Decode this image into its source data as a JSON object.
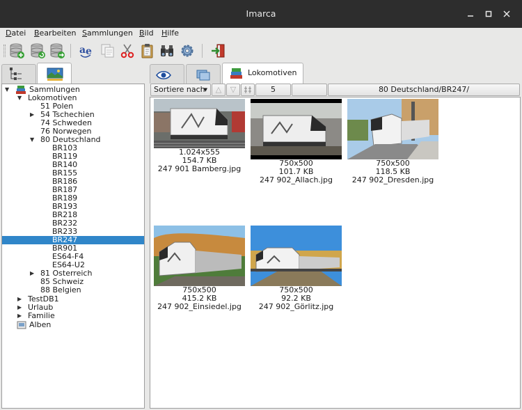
{
  "window": {
    "title": "Imarca"
  },
  "menu": [
    {
      "pre": "",
      "key": "D",
      "rest": "atei"
    },
    {
      "pre": "",
      "key": "B",
      "rest": "earbeiten"
    },
    {
      "pre": "",
      "key": "S",
      "rest": "ammlungen"
    },
    {
      "pre": "",
      "key": "B",
      "rest": "ild"
    },
    {
      "pre": "",
      "key": "H",
      "rest": "ilfe"
    }
  ],
  "toolbar_icons": [
    "database-add-icon",
    "database-refresh-icon",
    "database-sync-icon",
    "spellcheck-icon",
    "copy-icon",
    "cut-icon",
    "paste-icon",
    "binoculars-icon",
    "settings-gear-icon",
    "exit-icon"
  ],
  "tree": {
    "root": "Sammlungen",
    "lokomotiven": "Lokomotiven",
    "items": {
      "polen": "51 Polen",
      "tschechien": "54 Tschechien",
      "schweden": "74 Schweden",
      "norwegen": "76 Norwegen",
      "deutschland": "80 Deutschland",
      "oesterreich": "81 Osterreich",
      "schweiz": "85 Schweiz",
      "belgien": "88 Belgien"
    },
    "br": [
      "BR103",
      "BR119",
      "BR140",
      "BR155",
      "BR186",
      "BR187",
      "BR189",
      "BR193",
      "BR218",
      "BR232",
      "BR233",
      "BR247",
      "BR901",
      "ES64-F4",
      "ES64-U2"
    ],
    "selected": "BR247",
    "testdb": "TestDB1",
    "urlaub": "Urlaub",
    "familie": "Familie",
    "alben": "Alben"
  },
  "right_tab": {
    "label": "Lokomotiven"
  },
  "controls": {
    "sort_label": "Sortiere nach",
    "count": "5",
    "path": "80 Deutschland/BR247/"
  },
  "images": [
    {
      "dims": "1.024x555",
      "size": "154.7 KB",
      "name": "247 901 Bamberg.jpg"
    },
    {
      "dims": "750x500",
      "size": "101.7 KB",
      "name": "247 902_Allach.jpg"
    },
    {
      "dims": "750x500",
      "size": "118.5 KB",
      "name": "247 902_Dresden.jpg"
    },
    {
      "dims": "750x500",
      "size": "415.2 KB",
      "name": "247 902_Einsiedel.jpg"
    },
    {
      "dims": "750x500",
      "size": "92.2 KB",
      "name": "247 902_Görlitz.jpg"
    }
  ],
  "colors": {
    "selection": "#3086c9",
    "titlebar": "#2d2d2d",
    "window_bg": "#e8e8e7"
  }
}
